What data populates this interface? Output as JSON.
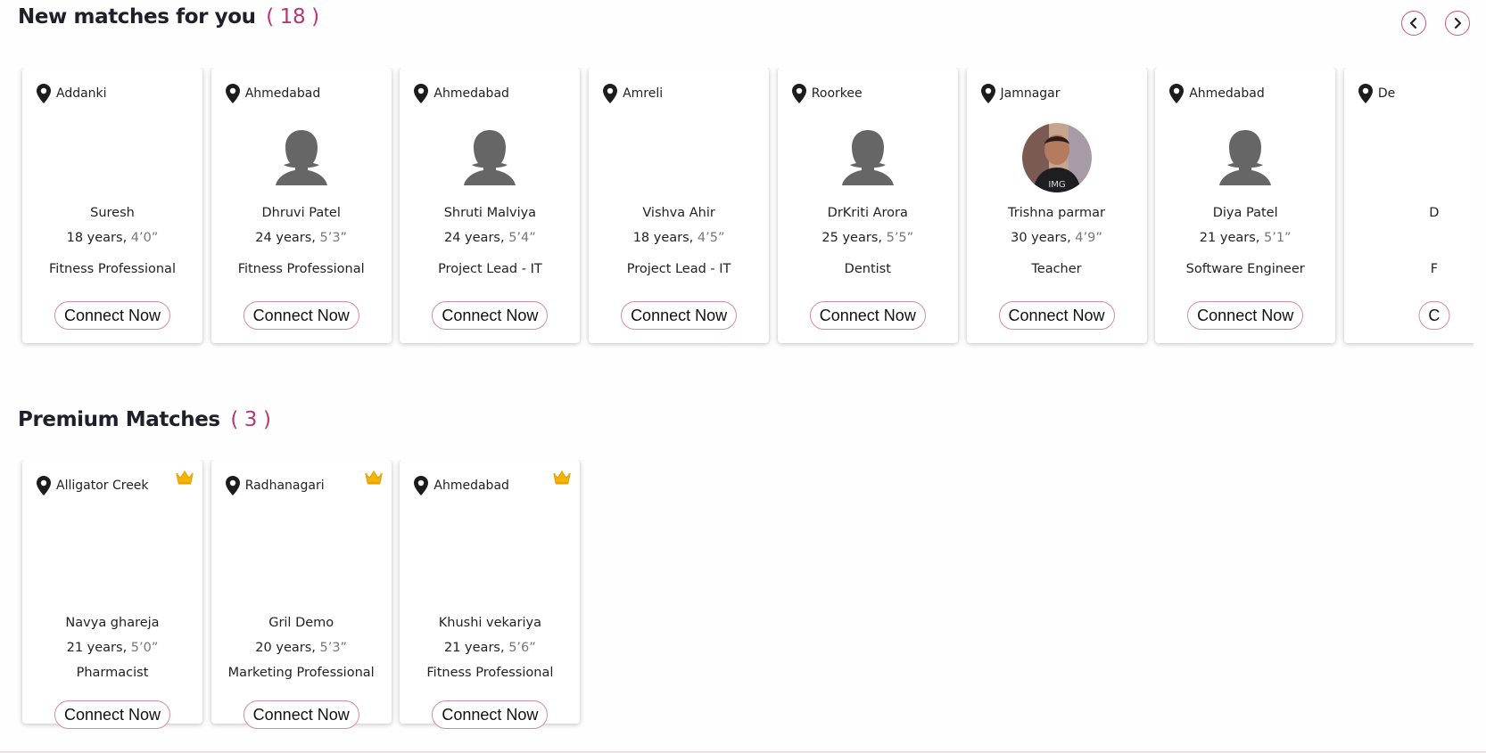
{
  "new_matches": {
    "title": "New matches for you",
    "count": "18",
    "cards": [
      {
        "location": "Addanki",
        "name": "Suresh",
        "age": "18 years,",
        "height": "4’0”",
        "job": "Fitness Professional",
        "avatar": "none",
        "button": "Connect Now"
      },
      {
        "location": "Ahmedabad",
        "name": "Dhruvi Patel",
        "age": "24 years,",
        "height": "5’3”",
        "job": "Fitness Professional",
        "avatar": "female-placeholder-icon",
        "button": "Connect Now"
      },
      {
        "location": "Ahmedabad",
        "name": "Shruti Malviya",
        "age": "24 years,",
        "height": "5’4”",
        "job": "Project Lead - IT",
        "avatar": "female-placeholder-icon",
        "button": "Connect Now"
      },
      {
        "location": "Amreli",
        "name": "Vishva Ahir",
        "age": "18 years,",
        "height": "4’5”",
        "job": "Project Lead - IT",
        "avatar": "none",
        "button": "Connect Now"
      },
      {
        "location": "Roorkee",
        "name": "DrKriti Arora",
        "age": "25 years,",
        "height": "5’5”",
        "job": "Dentist",
        "avatar": "female-placeholder-icon",
        "button": "Connect Now"
      },
      {
        "location": "Jamnagar",
        "name": "Trishna parmar",
        "age": "30 years,",
        "height": "4’9”",
        "job": "Teacher",
        "avatar": "profile-photo",
        "button": "Connect Now"
      },
      {
        "location": "Ahmedabad",
        "name": "Diya Patel",
        "age": "21 years,",
        "height": "5’1”",
        "job": "Software Engineer",
        "avatar": "female-placeholder-icon",
        "button": "Connect Now"
      },
      {
        "location": "De",
        "name": "D",
        "age": "",
        "height": "",
        "job": "F",
        "avatar": "none",
        "button": "C"
      }
    ]
  },
  "premium_matches": {
    "title": "Premium Matches",
    "count": "3",
    "cards": [
      {
        "location": "Alligator Creek",
        "name": "Navya ghareja",
        "age": "21 years,",
        "height": "5’0”",
        "job": "Pharmacist",
        "button": "Connect Now"
      },
      {
        "location": "Radhanagari",
        "name": "Gril Demo",
        "age": "20 years,",
        "height": "5’3”",
        "job": "Marketing Professional",
        "button": "Connect Now"
      },
      {
        "location": "Ahmedabad",
        "name": "Khushi vekariya",
        "age": "21 years,",
        "height": "5’6”",
        "job": "Fitness Professional",
        "button": "Connect Now"
      }
    ]
  },
  "colors": {
    "accent": "#b73772",
    "border": "#d48aa8",
    "placeholder": "#6a6a6a"
  }
}
